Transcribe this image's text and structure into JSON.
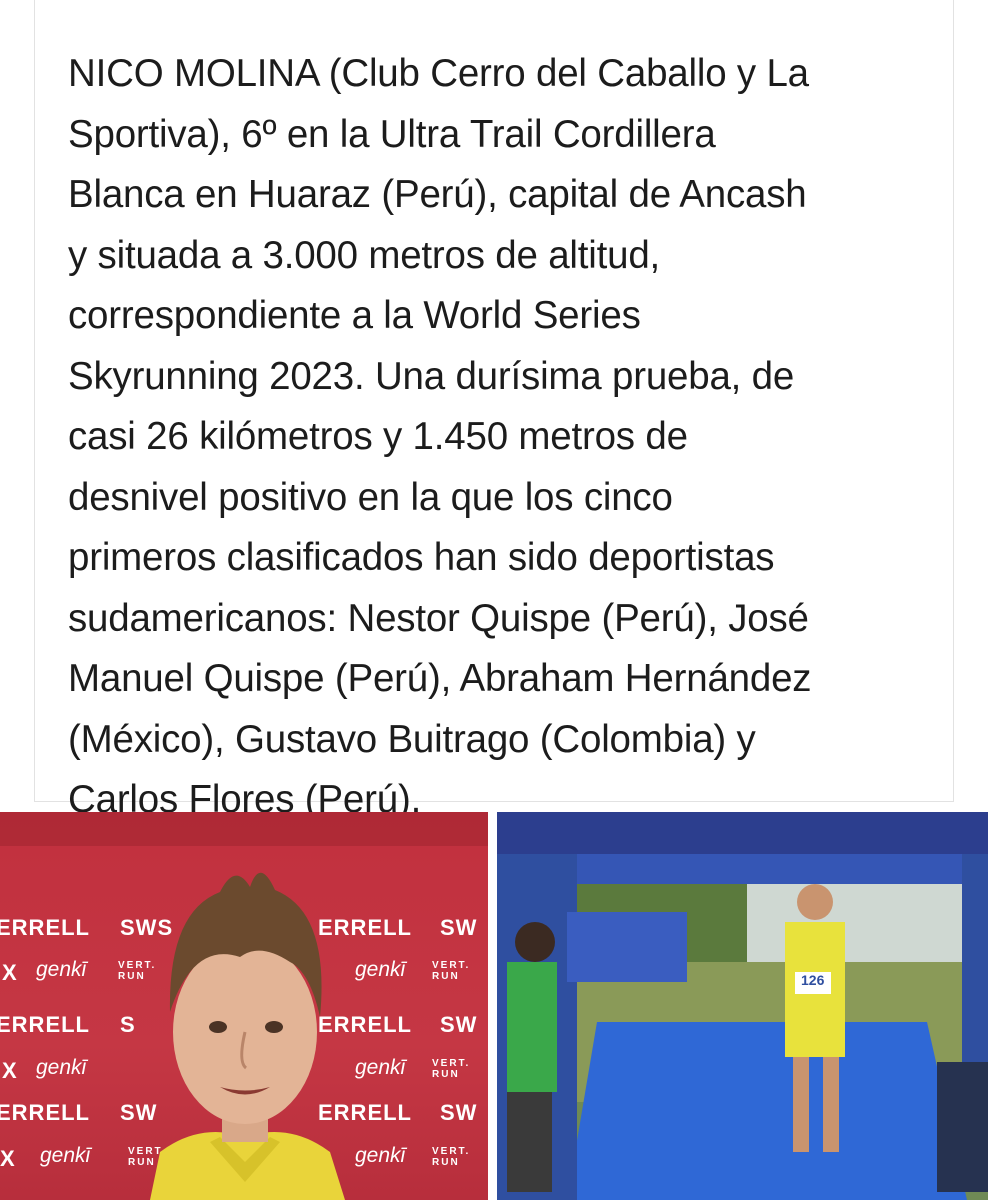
{
  "post": {
    "lines": [
      "NICO MOLINA (Club Cerro del Caballo y La",
      "Sportiva), 6º en la Ultra Trail Cordillera",
      "Blanca en Huaraz (Perú), capital de Ancash",
      "y situada a 3.000 metros de altitud,",
      "correspondiente a la World Series",
      "Skyrunning 2023. Una durísima prueba, de",
      "casi 26 kilómetros y 1.450 metros de",
      "desnivel positivo en la que los cinco",
      "primeros clasificados han sido deportistas",
      "sudamericanos: Nestor Quispe (Perú), José",
      "Manuel Quispe (Perú), Abraham Hernández",
      "(México), Gustavo Buitrago (Colombia) y",
      "Carlos Flores (Perú)."
    ]
  },
  "photo_left": {
    "backdrop": {
      "brand_a": "ERRELL",
      "brand_b": "SWS",
      "brand_b_short": "S",
      "brand_b_mid": "SW",
      "brand_c": "genkī",
      "brand_c_x": "X",
      "brand_d_top": "VERT.",
      "brand_d_bottom": "RUN"
    },
    "colors": {
      "backdrop": "#c53744",
      "jacket": "#e9d43a",
      "hair": "#6b4a2e"
    }
  },
  "photo_right": {
    "bib_number": "126",
    "colors": {
      "arch": "#2f4fa0",
      "ground": "#2f68d6",
      "runner_shirt": "#e8e23c"
    }
  }
}
